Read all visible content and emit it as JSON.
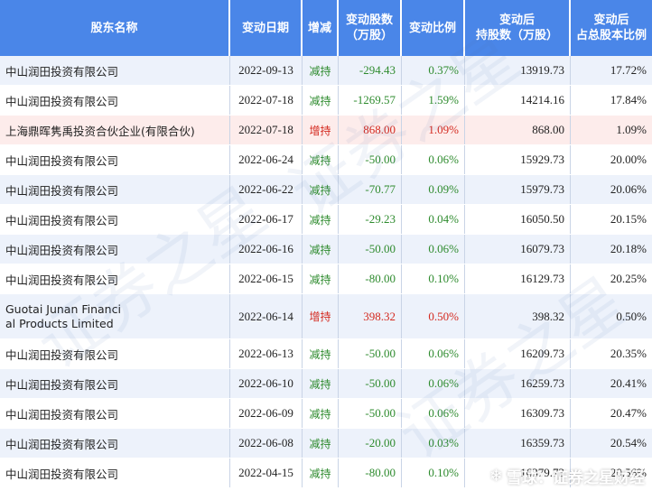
{
  "headers": [
    [
      "股东名称"
    ],
    [
      "变动日期"
    ],
    [
      "增减"
    ],
    [
      "变动股数",
      "（万股）"
    ],
    [
      "变动比例"
    ],
    [
      "变动后",
      "持股数（万股）"
    ],
    [
      "变动后",
      "占总股本比例"
    ]
  ],
  "rows": [
    {
      "name": "中山润田投资有限公司",
      "date": "2022-09-13",
      "type": "减持",
      "shares": "-294.43",
      "ratio": "0.37%",
      "after": "13919.73",
      "pct": "17.72%"
    },
    {
      "name": "中山润田投资有限公司",
      "date": "2022-07-18",
      "type": "减持",
      "shares": "-1269.57",
      "ratio": "1.59%",
      "after": "14214.16",
      "pct": "17.84%"
    },
    {
      "name": "上海鼎晖隽禹投资合伙企业(有限合伙)",
      "date": "2022-07-18",
      "type": "增持",
      "shares": "868.00",
      "ratio": "1.09%",
      "after": "868.00",
      "pct": "1.09%"
    },
    {
      "name": "中山润田投资有限公司",
      "date": "2022-06-24",
      "type": "减持",
      "shares": "-50.00",
      "ratio": "0.06%",
      "after": "15929.73",
      "pct": "20.00%"
    },
    {
      "name": "中山润田投资有限公司",
      "date": "2022-06-22",
      "type": "减持",
      "shares": "-70.77",
      "ratio": "0.09%",
      "after": "15979.73",
      "pct": "20.06%"
    },
    {
      "name": "中山润田投资有限公司",
      "date": "2022-06-17",
      "type": "减持",
      "shares": "-29.23",
      "ratio": "0.04%",
      "after": "16050.50",
      "pct": "20.15%"
    },
    {
      "name": "中山润田投资有限公司",
      "date": "2022-06-16",
      "type": "减持",
      "shares": "-50.00",
      "ratio": "0.06%",
      "after": "16079.73",
      "pct": "20.18%"
    },
    {
      "name": "中山润田投资有限公司",
      "date": "2022-06-15",
      "type": "减持",
      "shares": "-80.00",
      "ratio": "0.10%",
      "after": "16129.73",
      "pct": "20.25%"
    },
    {
      "name": "Guotai Junan Financi\nal Products Limited",
      "date": "2022-06-14",
      "type": "增持",
      "shares": "398.32",
      "ratio": "0.50%",
      "after": "398.32",
      "pct": "0.50%"
    },
    {
      "name": "中山润田投资有限公司",
      "date": "2022-06-13",
      "type": "减持",
      "shares": "-50.00",
      "ratio": "0.06%",
      "after": "16209.73",
      "pct": "20.35%"
    },
    {
      "name": "中山润田投资有限公司",
      "date": "2022-06-10",
      "type": "减持",
      "shares": "-50.00",
      "ratio": "0.06%",
      "after": "16259.73",
      "pct": "20.41%"
    },
    {
      "name": "中山润田投资有限公司",
      "date": "2022-06-09",
      "type": "减持",
      "shares": "-50.00",
      "ratio": "0.06%",
      "after": "16309.73",
      "pct": "20.47%"
    },
    {
      "name": "中山润田投资有限公司",
      "date": "2022-06-08",
      "type": "减持",
      "shares": "-20.00",
      "ratio": "0.03%",
      "after": "16359.73",
      "pct": "20.54%"
    },
    {
      "name": "中山润田投资有限公司",
      "date": "2022-04-15",
      "type": "减持",
      "shares": "-80.00",
      "ratio": "0.10%",
      "after": "16379.73",
      "pct": "20.56%"
    }
  ],
  "watermark": "证券之星",
  "brand": {
    "icon": "snowball-icon",
    "text": "雪球：证券之星财经"
  },
  "colors": {
    "header_bg": "#4a86e8",
    "decrease": "#2e8b2e",
    "increase": "#d4291f",
    "row_alt": "#edf2fb",
    "row_highlight": "#fdeceb"
  }
}
